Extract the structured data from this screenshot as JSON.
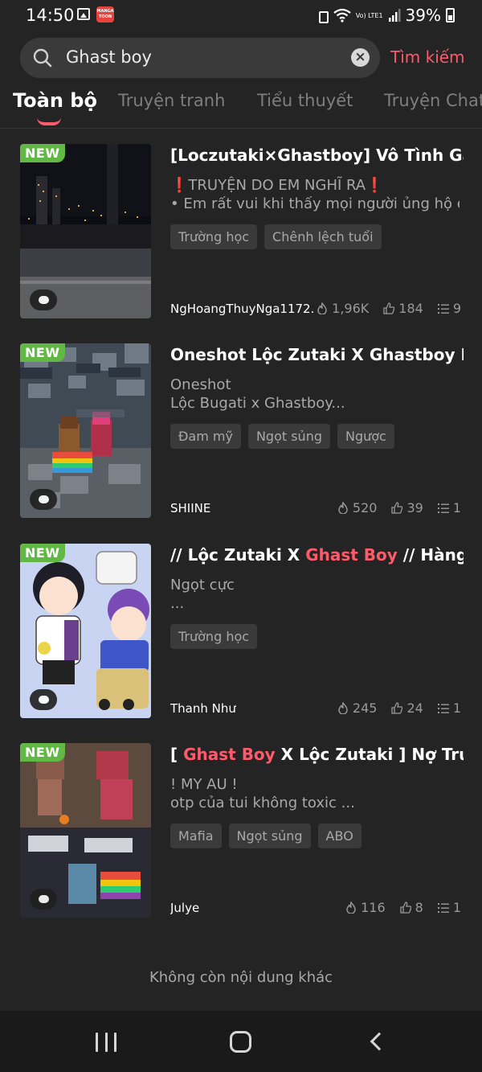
{
  "status_bar": {
    "time": "14:50",
    "app_badge": "MANGA TOON",
    "network": "Vo) LTE1",
    "battery": "39%"
  },
  "search": {
    "query": "Ghast boy",
    "submit_label": "Tìm kiếm"
  },
  "tabs": [
    {
      "label": "Toàn bộ",
      "active": true
    },
    {
      "label": "Truyện tranh",
      "active": false
    },
    {
      "label": "Tiểu thuyết",
      "active": false
    },
    {
      "label": "Truyện Chat",
      "active": false
    }
  ],
  "results": [
    {
      "badge": "NEW",
      "title": "[Loczutaki×Ghastboy] Vô Tình Gặp ...",
      "desc_line1": "TRUYỆN DO EM NGHĨ RA",
      "desc_line2": "• Em rất vui khi thấy mọi người ủng hộ e...",
      "tags": [
        "Trường học",
        "Chênh lệch tuổi"
      ],
      "author": "NgHoangThuyNga1172...",
      "views": "1,96K",
      "likes": "184",
      "chapters": "9"
    },
    {
      "badge": "NEW",
      "title": "Oneshot Lộc Zutaki X Ghastboy MÙ...",
      "desc_line1": "Oneshot",
      "desc_line2": "Lộc Bugati x Ghastboy...",
      "tags": [
        "Đam mỹ",
        "Ngọt sủng",
        "Ngược"
      ],
      "author": "SHIINE",
      "views": "520",
      "likes": "39",
      "chapters": "1"
    },
    {
      "badge": "NEW",
      "title_pre": "// Lộc Zutaki X ",
      "title_hl": "Ghast Boy",
      "title_post": " // Hàng X...",
      "desc_line1": "Ngọt cực",
      "desc_line2": "...",
      "tags": [
        "Trường học"
      ],
      "author": "Thanh Như",
      "views": "245",
      "likes": "24",
      "chapters": "1"
    },
    {
      "badge": "NEW",
      "title_pre": "[ ",
      "title_hl": "Ghast Boy",
      "title_post": " X Lộc Zutaki ] Nợ Truyề...",
      "desc_line1": "! MY AU !",
      "desc_line2": "otp của tui không toxic ...",
      "tags": [
        "Mafia",
        "Ngọt sủng",
        "ABO"
      ],
      "author": "Julye",
      "views": "116",
      "likes": "8",
      "chapters": "1"
    }
  ],
  "end_message": "Không còn nội dung khác",
  "colors": {
    "background": "#242424",
    "accent": "#ff5a6a",
    "new_badge": "#62b845"
  }
}
